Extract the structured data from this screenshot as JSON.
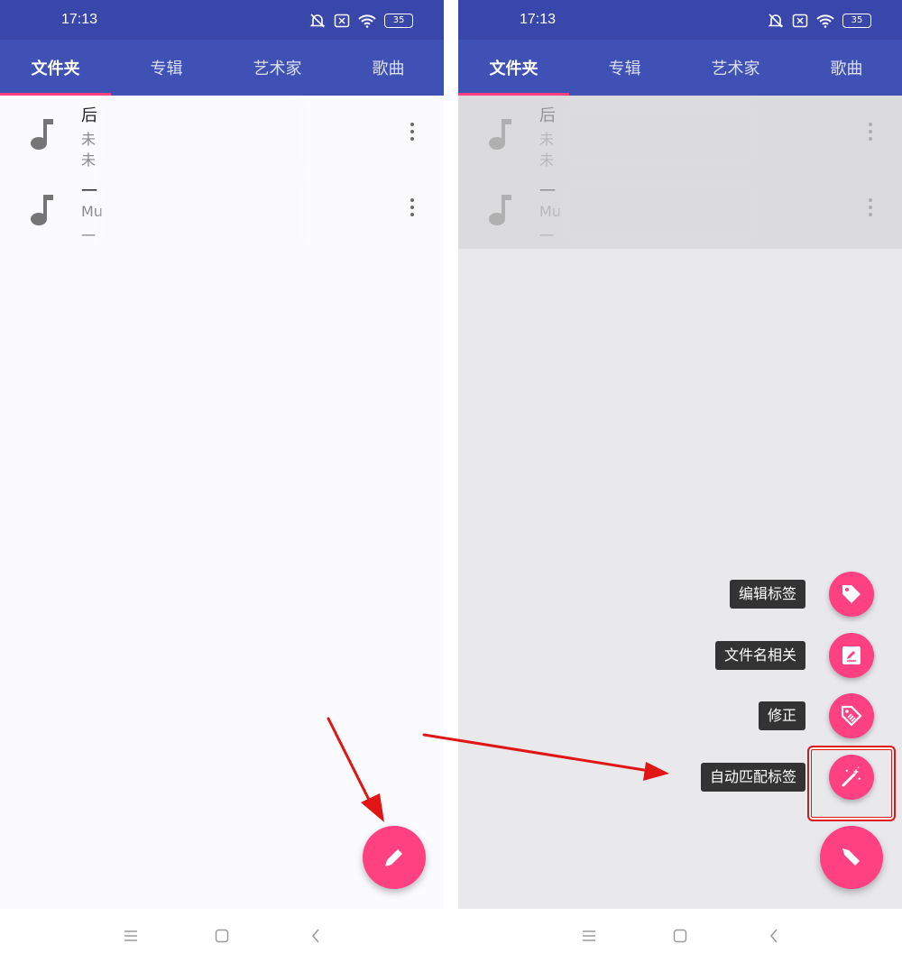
{
  "status_bar": {
    "time": "17:13",
    "battery": "35"
  },
  "tabs": [
    {
      "label": "文件夹",
      "active": true
    },
    {
      "label": "专辑",
      "active": false
    },
    {
      "label": "艺术家",
      "active": false
    },
    {
      "label": "歌曲",
      "active": false
    }
  ],
  "songs": [
    {
      "title": "后",
      "line1": "未",
      "line2": "未"
    },
    {
      "title": "一",
      "line1": "Mu",
      "line2": "一"
    }
  ],
  "fab_menu": [
    {
      "label": "编辑标签",
      "icon": "tag-icon"
    },
    {
      "label": "文件名相关",
      "icon": "rename-icon"
    },
    {
      "label": "修正",
      "icon": "tag-fix-icon"
    },
    {
      "label": "自动匹配标签",
      "icon": "magic-wand-icon"
    }
  ],
  "colors": {
    "primary": "#3f51b5",
    "status_bar": "#3946aa",
    "accent": "#ff4081",
    "annotation": "#e01616"
  }
}
